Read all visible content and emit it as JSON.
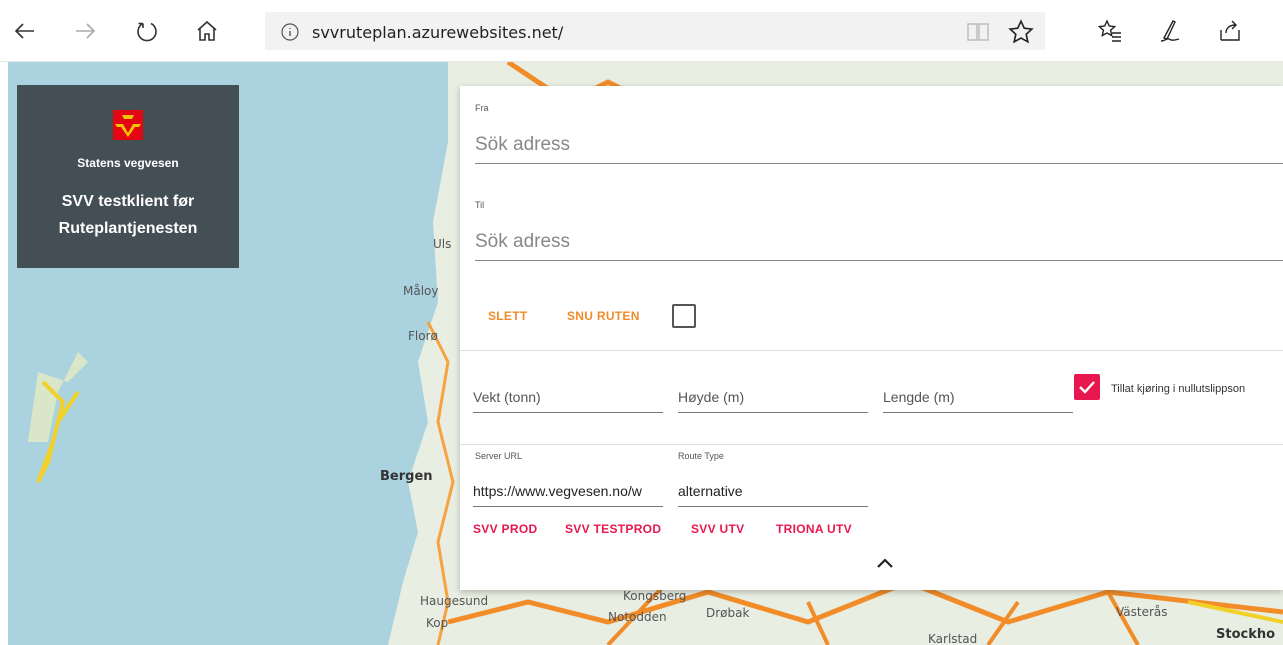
{
  "browser": {
    "url": "svvruteplan.azurewebsites.net/"
  },
  "map": {
    "labels": [
      "Uls",
      "Måloy",
      "Florø",
      "Bergen",
      "Haugesund",
      "Kongsberg",
      "Notodden",
      "Drøbak",
      "Karlstad",
      "Västerås",
      "Stockho",
      "Kop"
    ]
  },
  "brand": {
    "org": "Statens vegvesen",
    "title_line1": "SVV testklient før",
    "title_line2": "Ruteplantjenesten"
  },
  "form": {
    "from": {
      "label": "Fra",
      "placeholder": "Sök adress"
    },
    "to": {
      "label": "Til",
      "placeholder": "Sök adress"
    },
    "clear_label": "SLETT",
    "reverse_label": "SNU RUTEN",
    "weight_placeholder": "Vekt (tonn)",
    "height_placeholder": "Høyde (m)",
    "length_placeholder": "Lengde (m)",
    "zero_emission_label": "Tillat kjøring i nullutslippson",
    "server_url_label": "Server URL",
    "server_url_value": "https://www.vegvesen.no/w",
    "route_type_label": "Route Type",
    "route_type_value": "alternative",
    "presets": [
      "SVV PROD",
      "SVV TESTPROD",
      "SVV UTV",
      "TRIONA UTV"
    ]
  },
  "colors": {
    "accent_orange": "#ef8c2a",
    "accent_pink": "#e8174f",
    "brand_bg": "#444f55"
  }
}
